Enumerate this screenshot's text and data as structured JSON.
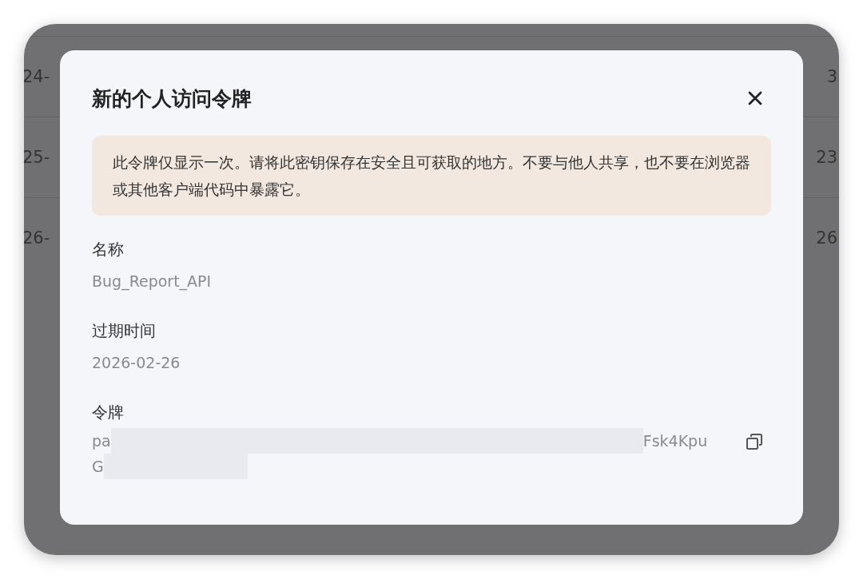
{
  "background_table": {
    "rows": [
      {
        "column_1": "24-",
        "column_2": "3"
      },
      {
        "column_1": "25-",
        "column_2": "23"
      },
      {
        "column_1": "26-",
        "column_2": "26"
      }
    ]
  },
  "dialog": {
    "title": "新的个人访问令牌",
    "notice": "此令牌仅显示一次。请将此密钥保存在安全且可获取的地方。不要与他人共享，也不要在浏览器或其他客户端代码中暴露它。",
    "fields": [
      {
        "label": "名称",
        "value": "Bug_Report_API"
      },
      {
        "label": "过期时间",
        "value": "2026-02-26"
      }
    ],
    "token": {
      "label": "令牌",
      "line_1_start": "pa",
      "line_1_end": "Fsk4Kpu",
      "line_2_start": "G"
    }
  }
}
